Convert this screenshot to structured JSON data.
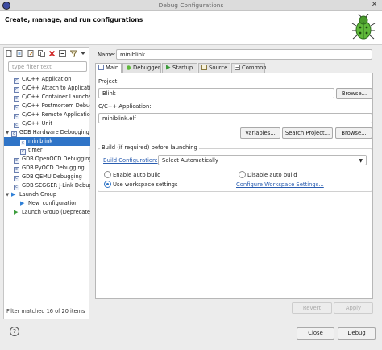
{
  "window": {
    "title": "Debug Configurations"
  },
  "header": {
    "text": "Create, manage, and run configurations"
  },
  "left": {
    "filter_placeholder": "type filter text",
    "tree": [
      {
        "label": "C/C++ Application",
        "level": 1,
        "kind": "ico"
      },
      {
        "label": "C/C++ Attach to Application",
        "level": 1,
        "kind": "ico"
      },
      {
        "label": "C/C++ Container Launcher",
        "level": 1,
        "kind": "ico"
      },
      {
        "label": "C/C++ Postmortem Debugger",
        "level": 1,
        "kind": "ico"
      },
      {
        "label": "C/C++ Remote Application",
        "level": 1,
        "kind": "ico"
      },
      {
        "label": "C/C++ Unit",
        "level": 1,
        "kind": "ico"
      },
      {
        "label": "GDB Hardware Debugging",
        "level": 0,
        "kind": "ico",
        "expanded": true
      },
      {
        "label": "miniblink",
        "level": 2,
        "kind": "ico",
        "selected": true
      },
      {
        "label": "timer",
        "level": 2,
        "kind": "ico"
      },
      {
        "label": "GDB OpenOCD Debugging",
        "level": 1,
        "kind": "ico"
      },
      {
        "label": "GDB PyOCD Debugging",
        "level": 1,
        "kind": "ico"
      },
      {
        "label": "GDB QEMU Debugging",
        "level": 1,
        "kind": "ico"
      },
      {
        "label": "GDB SEGGER J-Link Debugging",
        "level": 1,
        "kind": "ico"
      },
      {
        "label": "Launch Group",
        "level": 0,
        "kind": "play-up",
        "expanded": true
      },
      {
        "label": "New_configuration",
        "level": 2,
        "kind": "play-up"
      },
      {
        "label": "Launch Group (Deprecated)",
        "level": 1,
        "kind": "play"
      }
    ],
    "matched_text": "Filter matched 16 of 20 items"
  },
  "main": {
    "name_label": "Name:",
    "name_value": "miniblink",
    "tabs": [
      "Main",
      "Debugger",
      "Startup",
      "Source",
      "Common"
    ],
    "project_label": "Project:",
    "project_value": "Blink",
    "browse1": "Browse...",
    "app_label": "C/C++ Application:",
    "app_value": "miniblink.elf",
    "variables": "Variables...",
    "search_project": "Search Project...",
    "browse2": "Browse...",
    "build_group": "Build (if required) before launching",
    "build_config_label": "Build Configuration:",
    "build_config_value": "Select Automatically",
    "enable_auto": "Enable auto build",
    "disable_auto": "Disable auto build",
    "use_workspace": "Use workspace settings",
    "configure_workspace": "Configure Workspace Settings...",
    "revert": "Revert",
    "apply": "Apply"
  },
  "footer": {
    "help": "?",
    "close": "Close",
    "debug": "Debug"
  },
  "colors": {
    "selection": "#2f74c7",
    "link": "#2a5db0",
    "bug_green": "#5fb83a"
  }
}
